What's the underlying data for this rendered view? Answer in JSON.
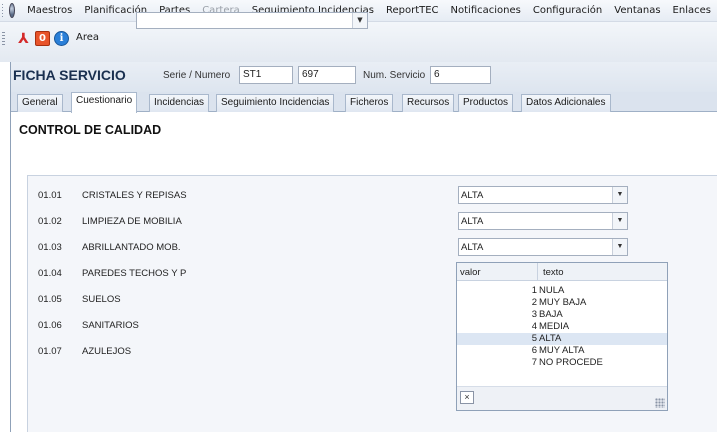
{
  "menu": {
    "items": [
      {
        "label": "Maestros",
        "disabled": false
      },
      {
        "label": "Planificación",
        "disabled": false
      },
      {
        "label": "Partes",
        "disabled": false
      },
      {
        "label": "Cartera",
        "disabled": true
      },
      {
        "label": "Seguimiento Incidencias",
        "disabled": false
      },
      {
        "label": "ReportTEC",
        "disabled": false
      },
      {
        "label": "Notificaciones",
        "disabled": false
      },
      {
        "label": "Configuración",
        "disabled": false
      },
      {
        "label": "Ventanas",
        "disabled": false
      },
      {
        "label": "Enlaces",
        "disabled": false
      }
    ]
  },
  "toolbar": {
    "area_label": "Area",
    "area_value": "",
    "icons": [
      "pdf-icon",
      "stop-icon",
      "info-icon"
    ]
  },
  "header": {
    "title": "FICHA SERVICIO",
    "serie_label": "Serie / Numero",
    "serie_value": "ST1",
    "numero_value": "697",
    "num_servicio_label": "Num. Servicio",
    "num_servicio_value": "6"
  },
  "tabs": [
    {
      "label": "General",
      "active": false
    },
    {
      "label": "Cuestionario",
      "active": true
    },
    {
      "label": "Incidencias",
      "active": false
    },
    {
      "label": "Seguimiento Incidencias",
      "active": false
    },
    {
      "label": "Ficheros",
      "active": false
    },
    {
      "label": "Recursos",
      "active": false
    },
    {
      "label": "Productos",
      "active": false
    },
    {
      "label": "Datos Adicionales",
      "active": false
    }
  ],
  "section_title": "CONTROL DE CALIDAD",
  "questions": [
    {
      "code": "01.01",
      "desc": "CRISTALES Y REPISAS",
      "value": "ALTA"
    },
    {
      "code": "01.02",
      "desc": "LIMPIEZA DE MOBILIA",
      "value": "ALTA"
    },
    {
      "code": "01.03",
      "desc": "ABRILLANTADO MOB.",
      "value": "ALTA"
    },
    {
      "code": "01.04",
      "desc": "PAREDES TECHOS Y P",
      "value": ""
    },
    {
      "code": "01.05",
      "desc": "SUELOS",
      "value": ""
    },
    {
      "code": "01.06",
      "desc": "SANITARIOS",
      "value": ""
    },
    {
      "code": "01.07",
      "desc": "AZULEJOS",
      "value": ""
    }
  ],
  "dropdown": {
    "col_valor": "valor",
    "col_texto": "texto",
    "options": [
      {
        "valor": "1",
        "texto": "NULA",
        "selected": false
      },
      {
        "valor": "2",
        "texto": "MUY BAJA",
        "selected": false
      },
      {
        "valor": "3",
        "texto": "BAJA",
        "selected": false
      },
      {
        "valor": "4",
        "texto": "MEDIA",
        "selected": false
      },
      {
        "valor": "5",
        "texto": "ALTA",
        "selected": true
      },
      {
        "valor": "6",
        "texto": "MUY ALTA",
        "selected": false
      },
      {
        "valor": "7",
        "texto": "NO PROCEDE",
        "selected": false
      }
    ],
    "clear_label": "×"
  }
}
